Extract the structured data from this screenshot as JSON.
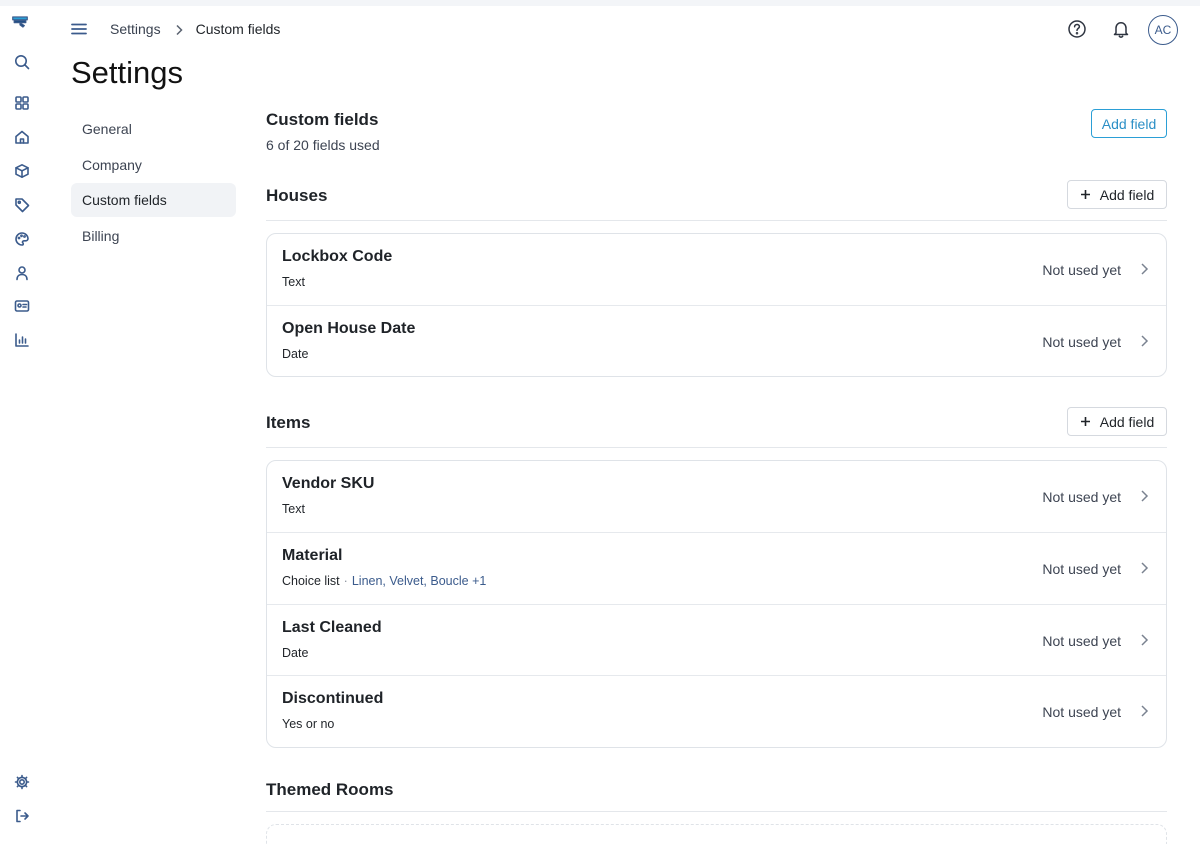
{
  "header": {
    "breadcrumbs": [
      "Settings",
      "Custom fields"
    ],
    "avatar_initials": "AC"
  },
  "page_title": "Settings",
  "settings_nav": [
    {
      "label": "General",
      "active": false
    },
    {
      "label": "Company",
      "active": false
    },
    {
      "label": "Custom fields",
      "active": true
    },
    {
      "label": "Billing",
      "active": false
    }
  ],
  "custom_fields": {
    "title": "Custom fields",
    "usage": "6 of 20 fields used",
    "add_button": "Add field"
  },
  "sections": [
    {
      "title": "Houses",
      "add_button": "Add field",
      "fields": [
        {
          "name": "Lockbox Code",
          "type": "Text",
          "status": "Not used yet"
        },
        {
          "name": "Open House Date",
          "type": "Date",
          "status": "Not used yet"
        }
      ]
    },
    {
      "title": "Items",
      "add_button": "Add field",
      "fields": [
        {
          "name": "Vendor SKU",
          "type": "Text",
          "status": "Not used yet"
        },
        {
          "name": "Material",
          "type": "Choice list",
          "options": "Linen, Velvet, Boucle +1",
          "status": "Not used yet"
        },
        {
          "name": "Last Cleaned",
          "type": "Date",
          "status": "Not used yet"
        },
        {
          "name": "Discontinued",
          "type": "Yes or no",
          "status": "Not used yet"
        }
      ]
    },
    {
      "title": "Themed Rooms",
      "fields": []
    }
  ],
  "colors": {
    "accent": "#2b9fd6",
    "rail_icon": "#3b5b8c",
    "active_nav_bg": "#f1f3f6"
  },
  "rail_icons": [
    "logo-icon",
    "search-icon",
    "dashboard-icon",
    "home-icon",
    "box-icon",
    "tag-icon",
    "palette-icon",
    "user-icon",
    "id-card-icon",
    "bar-chart-icon",
    "settings-gear-icon",
    "logout-icon"
  ]
}
